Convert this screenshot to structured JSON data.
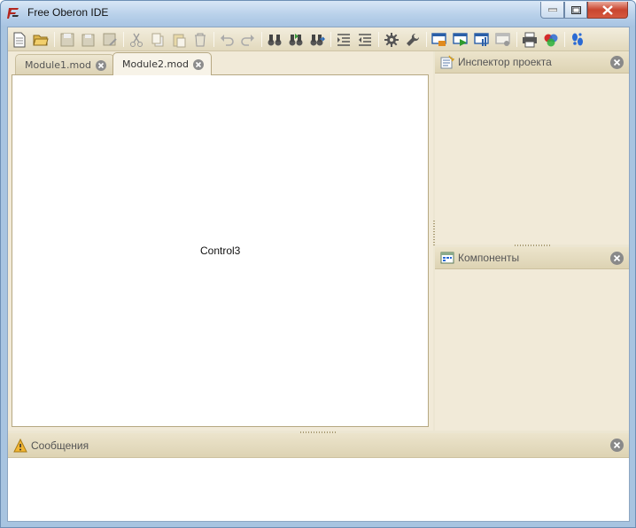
{
  "window": {
    "title": "Free Oberon IDE"
  },
  "toolbar": {
    "buttons": [
      "new-file",
      "open-file",
      "save",
      "save-all",
      "save-as",
      "cut",
      "copy",
      "paste",
      "delete",
      "undo",
      "redo",
      "find",
      "find-next",
      "replace",
      "indent",
      "unindent",
      "settings",
      "tools",
      "compile",
      "run",
      "build",
      "debug",
      "print",
      "colors",
      "about"
    ]
  },
  "tabs": [
    {
      "label": "Module1.mod",
      "active": false
    },
    {
      "label": "Module2.mod",
      "active": true
    }
  ],
  "editor": {
    "placeholder_label": "Control3"
  },
  "panels": {
    "inspector": {
      "title": "Инспектор проекта"
    },
    "components": {
      "title": "Компоненты"
    },
    "messages": {
      "title": "Сообщения"
    }
  },
  "colors": {
    "panel": "#f1ead8",
    "toolbar": "#e2d9bd",
    "border": "#b6a882",
    "titlebar": "#b9d1ea"
  }
}
